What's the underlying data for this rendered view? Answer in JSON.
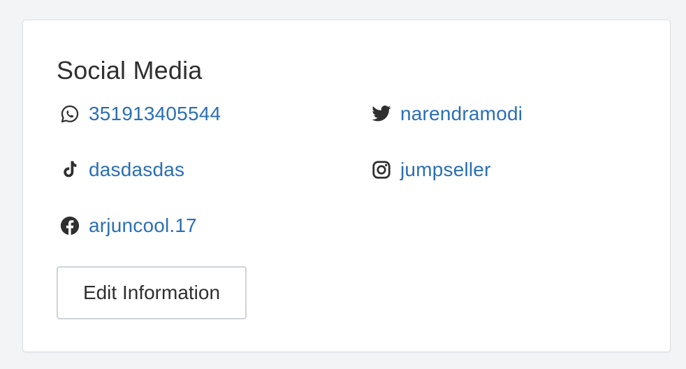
{
  "section": {
    "title": "Social Media"
  },
  "social": {
    "whatsapp": {
      "icon": "whatsapp-icon",
      "value": "351913405544"
    },
    "twitter": {
      "icon": "twitter-icon",
      "value": "narendramodi"
    },
    "tiktok": {
      "icon": "tiktok-icon",
      "value": "dasdasdas"
    },
    "instagram": {
      "icon": "instagram-icon",
      "value": "jumpseller"
    },
    "facebook": {
      "icon": "facebook-icon",
      "value": "arjuncool.17"
    }
  },
  "actions": {
    "edit_label": "Edit Information"
  },
  "colors": {
    "link": "#2a6fb5",
    "text": "#2f2f2f",
    "background": "#f3f4f6",
    "card": "#ffffff",
    "border": "#dcdfe4"
  }
}
